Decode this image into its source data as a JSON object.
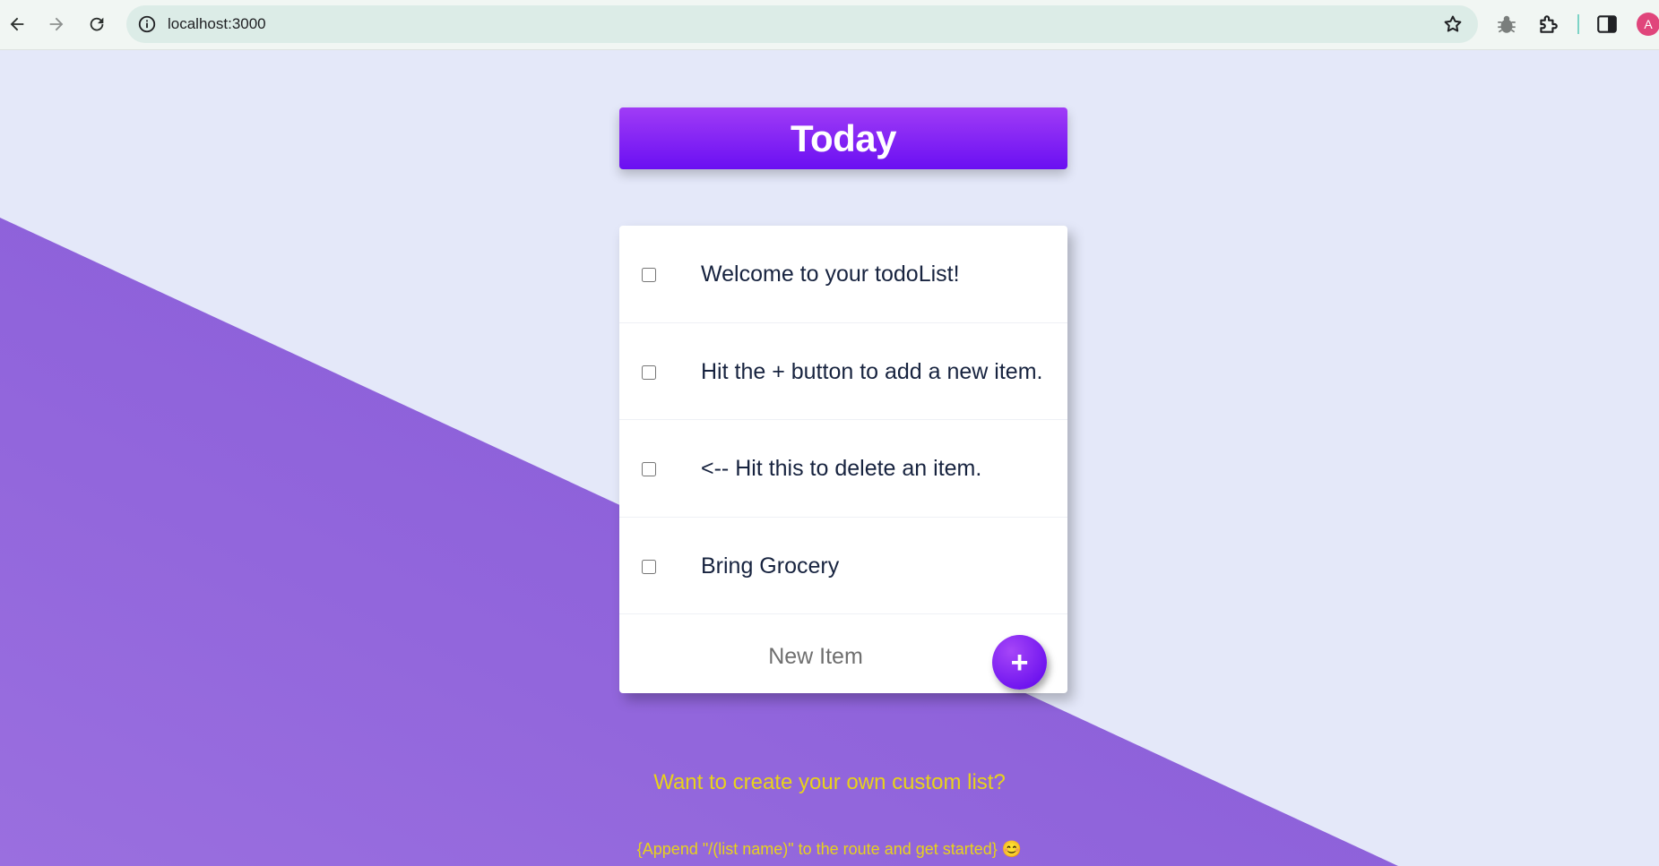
{
  "browser": {
    "url": "localhost:3000",
    "profile_initial": "A"
  },
  "list": {
    "title": "Today",
    "items": [
      {
        "text": "Welcome to your todoList!",
        "checked": false
      },
      {
        "text": "Hit the + button to add a new item.",
        "checked": false
      },
      {
        "text": "<-- Hit this to delete an item.",
        "checked": false
      },
      {
        "text": "Bring Grocery",
        "checked": false
      }
    ],
    "new_item_placeholder": "New Item",
    "add_button_label": "+"
  },
  "footer": {
    "question": "Want to create your own custom list?",
    "hint": "{Append \"/(list name)\" to the route and get started} 😊"
  },
  "colors": {
    "background": "#e4e8f9",
    "accent_purple": "#8b5ed9",
    "heading_gradient_top": "#a03cf6",
    "heading_gradient_bottom": "#6a0ff2",
    "footer_text": "#e8d21b"
  },
  "icons": [
    "back-arrow-icon",
    "forward-arrow-icon",
    "reload-icon",
    "site-info-icon",
    "bookmark-star-icon",
    "bug-extension-icon",
    "puzzle-extension-icon",
    "side-panel-icon"
  ]
}
